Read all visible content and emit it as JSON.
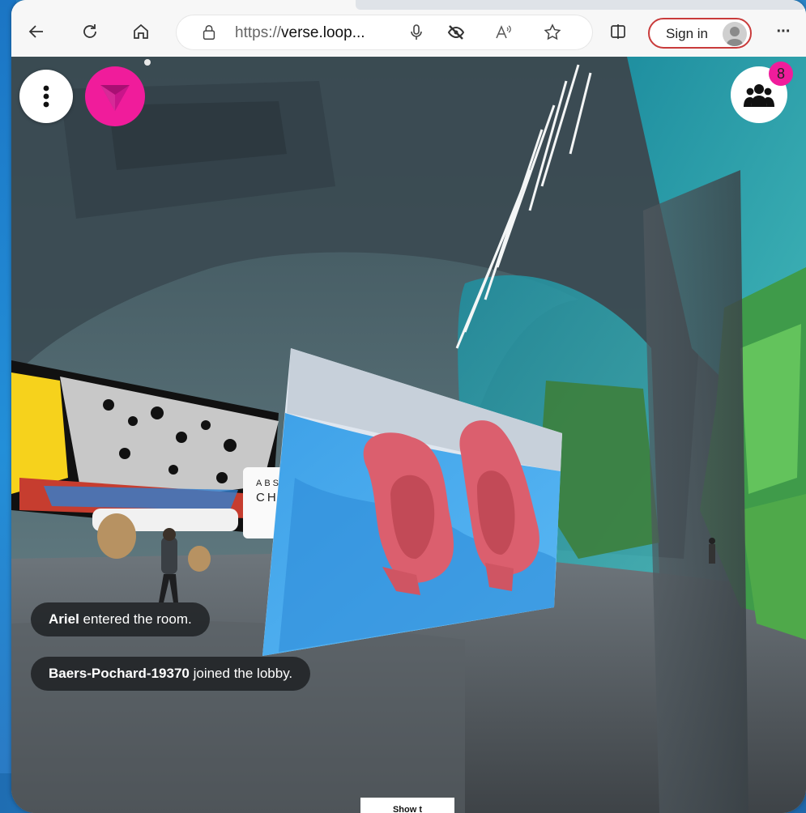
{
  "browser": {
    "url_prefix": "https://",
    "url_host": "verse.loop...",
    "sign_in_label": "Sign in",
    "more_label": "···"
  },
  "app": {
    "participant_count": "8",
    "accent": "#f01c9b"
  },
  "notifications": [
    {
      "name": "Ariel",
      "message": " entered the room."
    },
    {
      "name": "Baers-Pochard-19370",
      "message": " joined the lobby."
    }
  ],
  "taskbar": {
    "tooltip": "Show t"
  },
  "icons": [
    "back-arrow-icon",
    "refresh-icon",
    "home-icon",
    "lock-icon",
    "microphone-icon",
    "tracking-prevention-icon",
    "read-aloud-icon",
    "favorite-star-icon",
    "split-screen-icon",
    "profile-avatar-icon",
    "more-icon",
    "kebab-menu-icon",
    "logo-icon",
    "people-icon"
  ]
}
